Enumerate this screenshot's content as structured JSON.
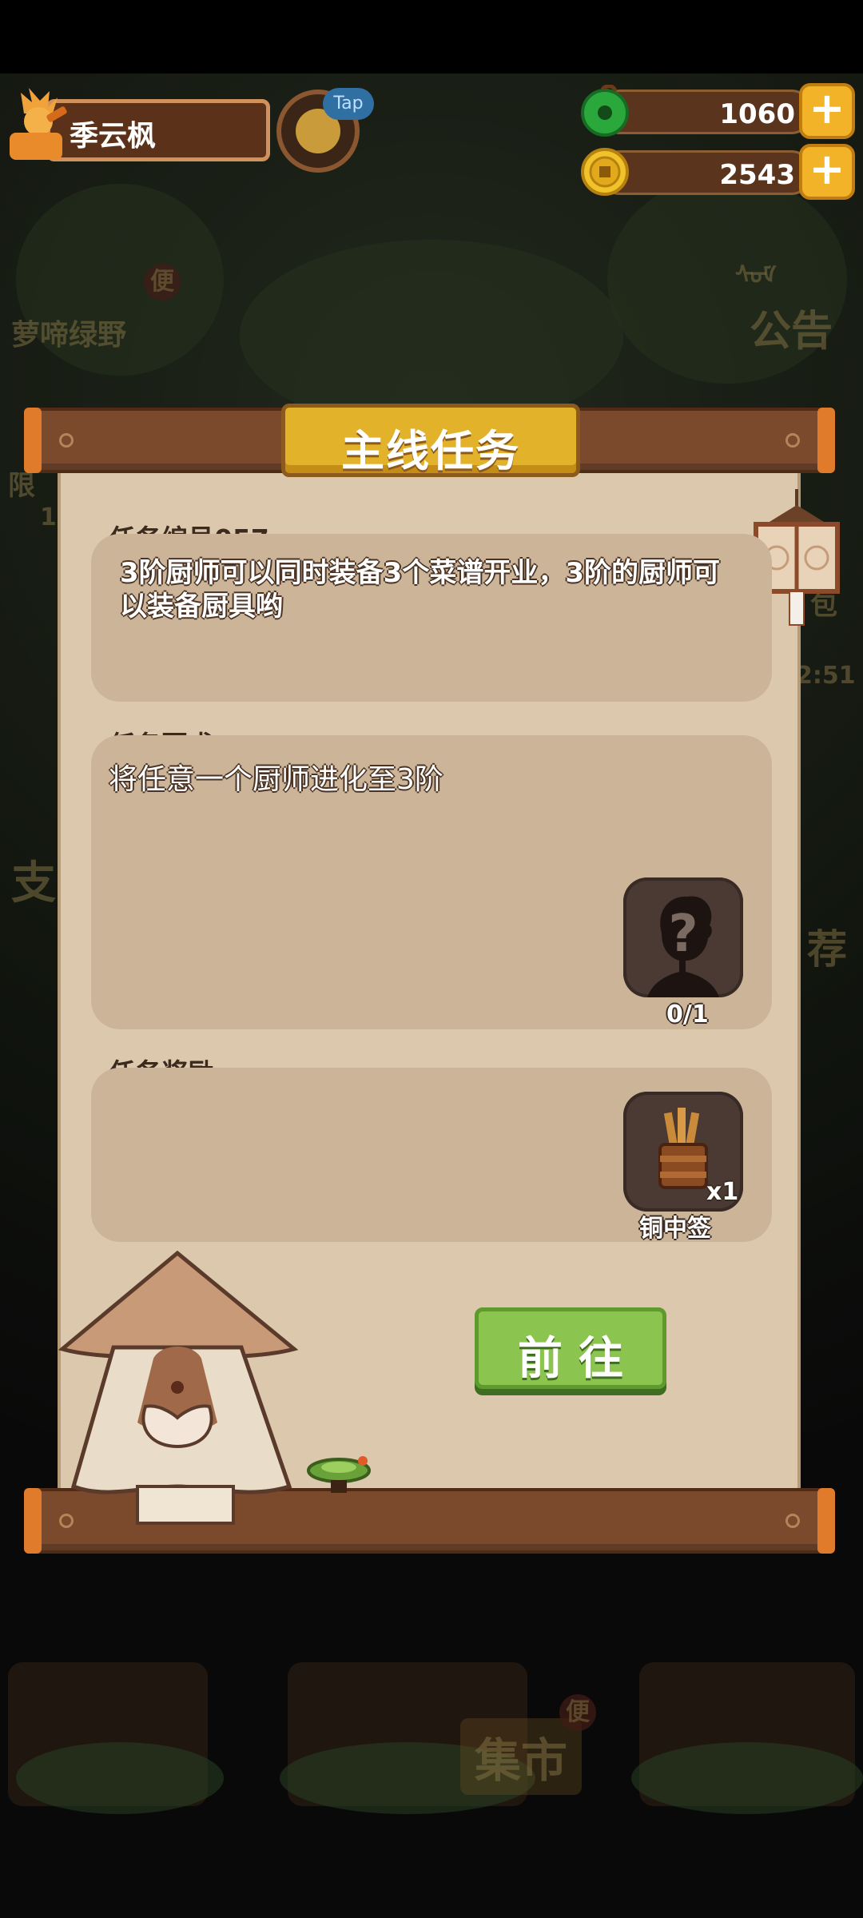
{
  "player": {
    "name": "季云枫",
    "tap_label": "Tap"
  },
  "resources": [
    {
      "icon": "jade-coin-icon",
      "value": "1060"
    },
    {
      "icon": "gold-coin-icon",
      "value": "2543"
    }
  ],
  "background": {
    "left_event_label": "萝啼绿野",
    "left_badge": "便",
    "notice_label": "公告",
    "notice_icon_text": "ᠰᠤᠮ",
    "limit_label": "限",
    "limit_count": "1",
    "left_side_label": "支",
    "right_side_label": "荐",
    "right_small_label": "包",
    "right_timer": "2:51",
    "market_label": "集市",
    "market_badge": "便"
  },
  "panel": {
    "title": "主线任务",
    "task_number_label": "任务编号057",
    "task_description": "3阶厨师可以同时装备3个菜谱开业，3阶的厨师可以装备厨具哟",
    "requirement_label": "任务要求",
    "requirement_text": "将任意一个厨师进化至3阶",
    "requirement_progress": "0/1",
    "reward_label": "任务奖励",
    "reward_item_name": "铜中签",
    "reward_quantity": "x1",
    "go_button": "前往"
  },
  "colors": {
    "panel_bg": "#dcc9ad",
    "title_gold": "#e2b22a",
    "wood": "#7b4a2d",
    "go_green": "#8cc450"
  }
}
